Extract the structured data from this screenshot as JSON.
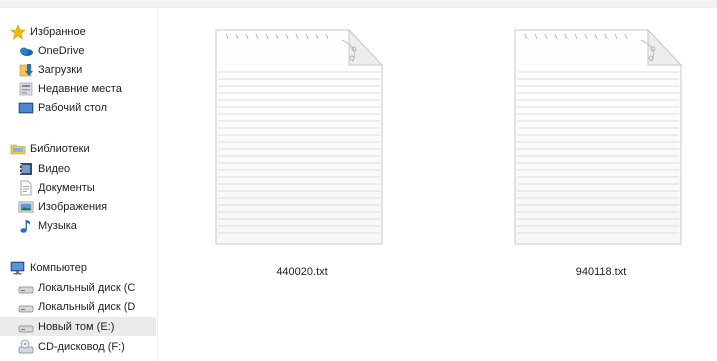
{
  "nav": {
    "favorites": {
      "header": "Избранное",
      "items": [
        {
          "label": "OneDrive",
          "icon": "onedrive-icon"
        },
        {
          "label": "Загрузки",
          "icon": "downloads-icon"
        },
        {
          "label": "Недавние места",
          "icon": "recent-places-icon"
        },
        {
          "label": "Рабочий стол",
          "icon": "desktop-icon"
        }
      ]
    },
    "libraries": {
      "header": "Библиотеки",
      "items": [
        {
          "label": "Видео",
          "icon": "video-icon"
        },
        {
          "label": "Документы",
          "icon": "documents-icon"
        },
        {
          "label": "Изображения",
          "icon": "pictures-icon"
        },
        {
          "label": "Музыка",
          "icon": "music-icon"
        }
      ]
    },
    "computer": {
      "header": "Компьютер",
      "items": [
        {
          "label": "Локальный диск (C",
          "icon": "drive-icon"
        },
        {
          "label": "Локальный диск (D",
          "icon": "drive-icon"
        },
        {
          "label": "Новый том (E:)",
          "icon": "drive-icon",
          "selected": true
        },
        {
          "label": "CD-дисковод (F:)",
          "icon": "cd-drive-icon"
        }
      ]
    }
  },
  "files": [
    {
      "name": "440020.txt",
      "icon": "text-file-icon"
    },
    {
      "name": "940118.txt",
      "icon": "text-file-icon"
    }
  ],
  "colors": {
    "selected_bg": "#ebebeb",
    "star": "#f5b800",
    "folder": "#f3c54a",
    "accent_blue": "#2a6ebd"
  }
}
